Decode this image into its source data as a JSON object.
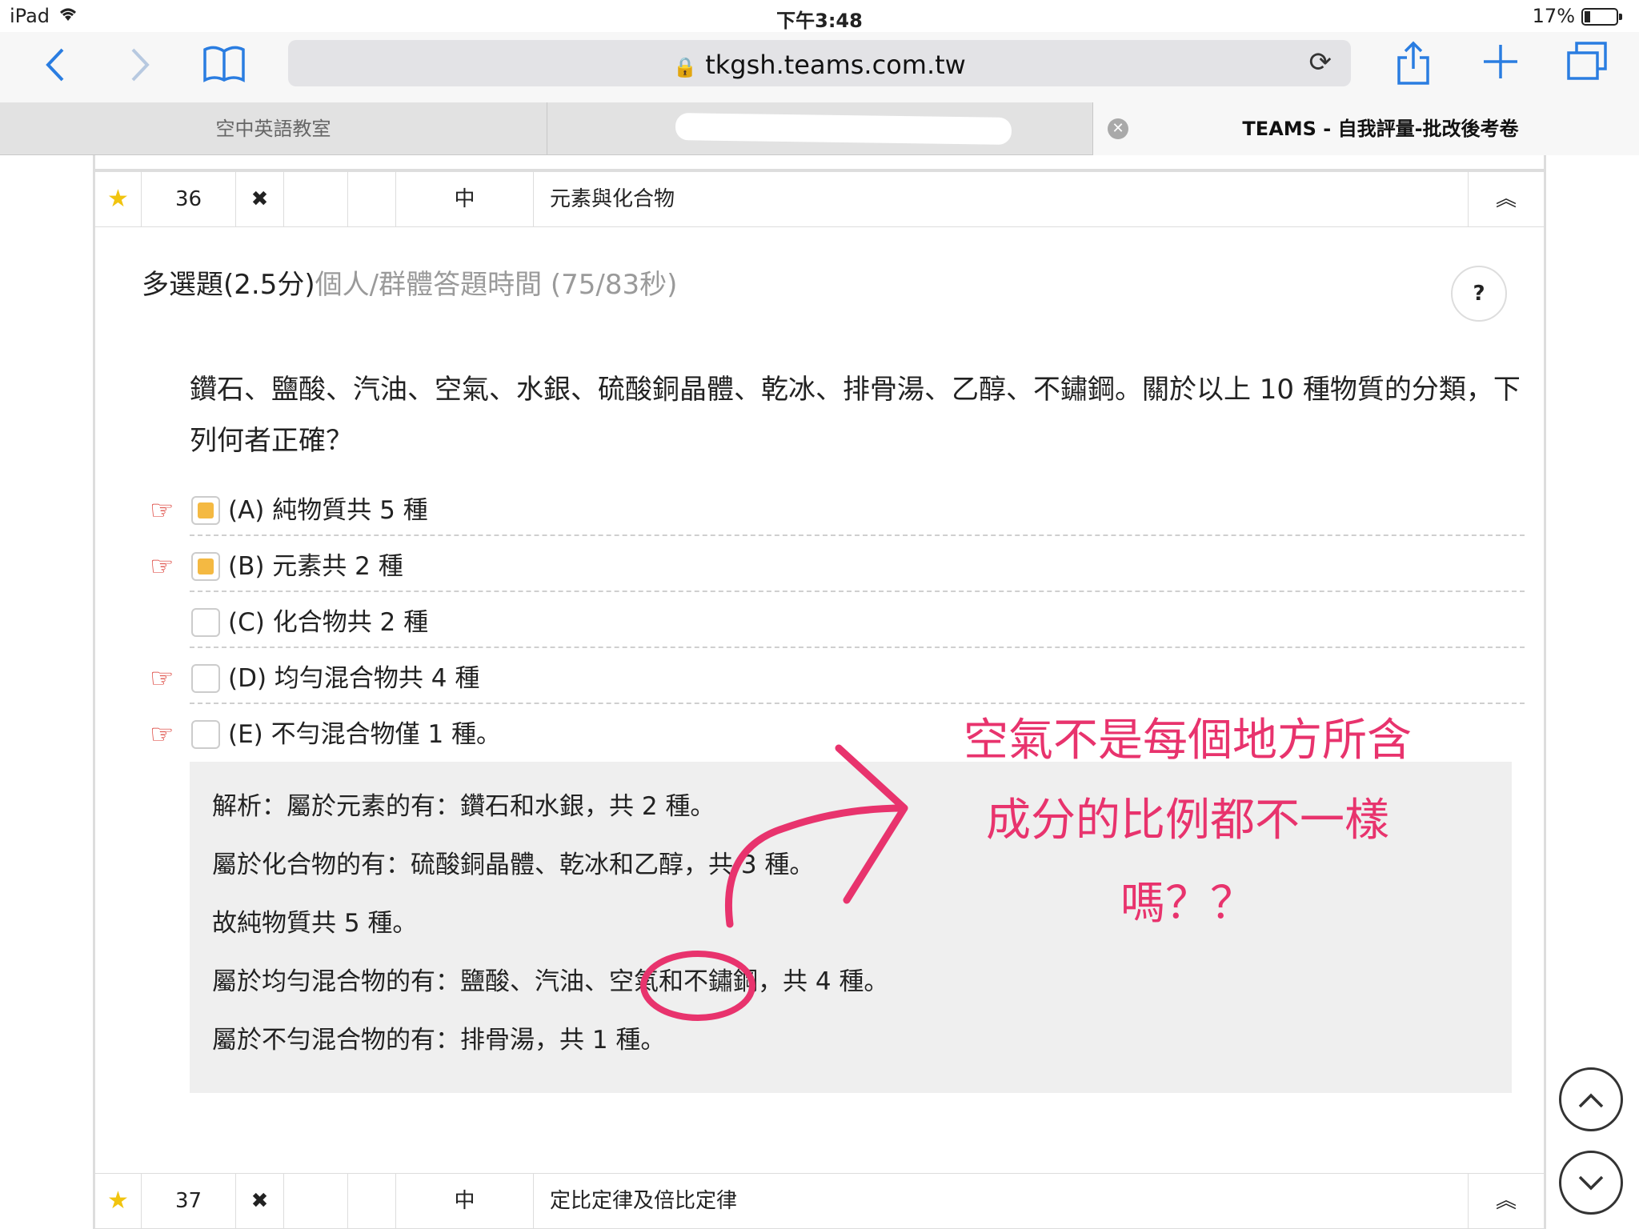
{
  "status": {
    "device": "iPad",
    "time": "下午3:48",
    "battery": "17%"
  },
  "browser": {
    "url": "tkgsh.teams.com.tw",
    "tabs": [
      {
        "label": "空中英語教室"
      },
      {
        "label": ""
      },
      {
        "label": "TEAMS - 自我評量-批改後考卷"
      }
    ]
  },
  "rows": [
    {
      "num": "36",
      "mark": "✖",
      "level": "中",
      "topic": "元素與化合物",
      "collapse": "︽"
    },
    {
      "num": "37",
      "mark": "✖",
      "level": "中",
      "topic": "定比定律及倍比定律",
      "collapse": "︽"
    }
  ],
  "question": {
    "type": "多選題(2.5分)",
    "timing": "個人/群體答題時間 (75/83秒)",
    "help": "?",
    "text": "鑽石、鹽酸、汽油、空氣、水銀、硫酸銅晶體、乾冰、排骨湯、乙醇、不鏽鋼。關於以上 10 種物質的分類，下列何者正確？",
    "options": [
      {
        "label": "(A) 純物質共 5 種",
        "checked": true,
        "correct": true
      },
      {
        "label": "(B) 元素共 2 種",
        "checked": true,
        "correct": true
      },
      {
        "label": "(C) 化合物共 2 種",
        "checked": false,
        "correct": false
      },
      {
        "label": "(D) 均勻混合物共 4 種",
        "checked": false,
        "correct": true
      },
      {
        "label": "(E) 不勻混合物僅 1 種。",
        "checked": false,
        "correct": true
      }
    ],
    "analysis": [
      "解析：屬於元素的有：鑽石和水銀，共 2 種。",
      "屬於化合物的有：硫酸銅晶體、乾冰和乙醇，共 3 種。",
      "故純物質共 5 種。",
      "屬於均勻混合物的有：鹽酸、汽油、空氣和不鏽鋼，共 4 種。",
      "屬於不勻混合物的有：排骨湯，共 1 種。"
    ]
  },
  "annotation": {
    "lines": [
      "空氣不是每個地方所含",
      "成分的比例都不一樣",
      "嗎？？"
    ],
    "color": "#e8336d"
  },
  "icons": {
    "back": "chevron-left-icon",
    "forward": "chevron-right-icon",
    "bookmarks": "book-icon",
    "lock": "lock-icon",
    "reload": "reload-icon",
    "share": "share-icon",
    "add": "plus-icon",
    "tabs": "tabs-icon",
    "star": "star-icon",
    "hand": "pointing-hand-icon",
    "scroll_up": "chevron-up-icon",
    "scroll_down": "chevron-down-icon"
  }
}
